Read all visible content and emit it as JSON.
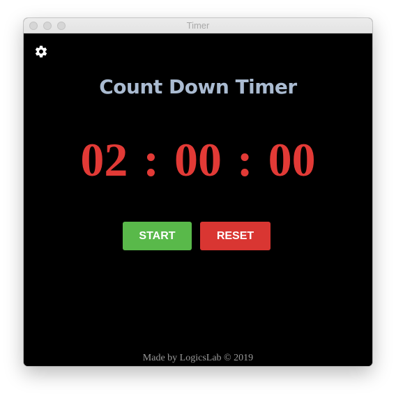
{
  "window": {
    "title": "Timer"
  },
  "app": {
    "title": "Count Down Timer",
    "settings_icon": "gear-icon"
  },
  "timer": {
    "hours": "02",
    "minutes": "00",
    "seconds": "00",
    "separator": ":"
  },
  "buttons": {
    "start_label": "START",
    "reset_label": "RESET"
  },
  "footer": {
    "text": "Made by LogicsLab © 2019"
  },
  "colors": {
    "background": "#000000",
    "title": "#aabbd1",
    "timer": "#e23a36",
    "start": "#59b94a",
    "reset": "#d93632"
  }
}
